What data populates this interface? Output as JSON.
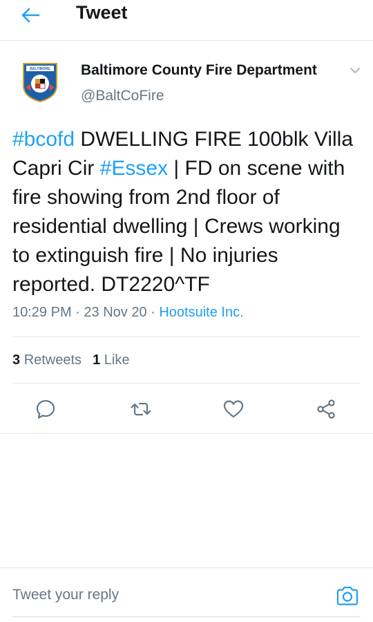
{
  "header": {
    "title": "Tweet",
    "back_icon": "arrow-left-icon"
  },
  "author": {
    "name": "Baltimore County Fire Department",
    "handle": "@BaltCoFire",
    "avatar_text": "BALTIMORE COUNTY"
  },
  "tweet": {
    "segments": [
      {
        "text": "#bcofd",
        "hashtag": true
      },
      {
        "text": " DWELLING FIRE 100blk Villa Capri Cir ",
        "hashtag": false
      },
      {
        "text": "#Essex",
        "hashtag": true
      },
      {
        "text": " | FD on scene with fire showing from 2nd floor of residential dwelling | Crews working to extinguish fire | No injuries reported. DT2220^TF",
        "hashtag": false
      }
    ],
    "time": "10:29 PM",
    "date": "23 Nov 20",
    "source": "Hootsuite Inc."
  },
  "stats": {
    "retweets_count": "3",
    "retweets_label": "Retweets",
    "likes_count": "1",
    "likes_label": "Like"
  },
  "actions": [
    "reply-icon",
    "retweet-icon",
    "like-icon",
    "share-icon"
  ],
  "reply": {
    "placeholder": "Tweet your reply",
    "camera_icon": "camera-icon"
  },
  "colors": {
    "accent": "#1da1f2",
    "text": "#14171a",
    "muted": "#657786",
    "divider": "#e1e8ed"
  }
}
